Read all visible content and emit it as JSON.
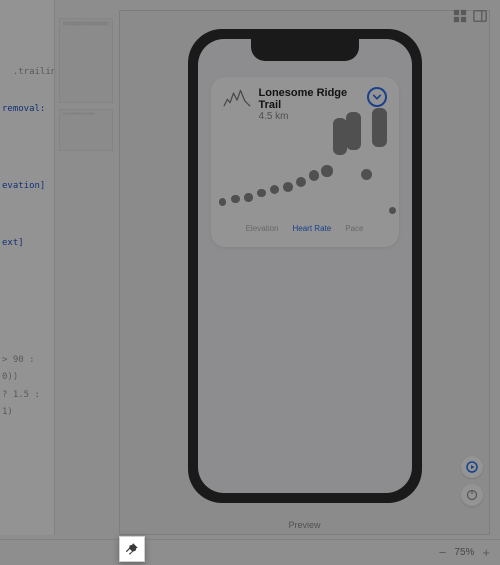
{
  "editor": {
    "snippets": [
      ".trailing)",
      "removal:",
      "evation]",
      "ext]",
      "> 90 : 0))",
      "? 1.5 : 1)"
    ],
    "keyword_color": "#2255cc"
  },
  "canvas": {
    "preview_label": "Preview",
    "toolbar": {
      "grid_icon": "grid-icon",
      "panel_icon": "panel-icon"
    },
    "controls": {
      "play": "play-icon",
      "refresh": "refresh-icon"
    }
  },
  "device": {
    "card": {
      "title": "Lonesome Ridge Trail",
      "subtitle": "4.5 km",
      "chevron": "chevron-down-icon",
      "ridge_icon": "ridge-icon"
    },
    "segments": [
      {
        "label": "Elevation",
        "active": false
      },
      {
        "label": "Heart Rate",
        "active": true
      },
      {
        "label": "Pace",
        "active": false
      }
    ]
  },
  "chart_data": {
    "type": "scatter",
    "title": "",
    "xlabel": "",
    "ylabel": "",
    "x": [
      0,
      1,
      2,
      3,
      4,
      5,
      6,
      7,
      8,
      9,
      10,
      11,
      12,
      13
    ],
    "values": [
      60,
      62,
      63,
      66,
      68,
      70,
      73,
      77,
      80,
      95,
      98,
      78,
      100,
      55
    ],
    "ylim": [
      50,
      105
    ],
    "size_scale": "value",
    "pill_indices": [
      9,
      10,
      12
    ],
    "color": "#8a8a8a",
    "series_name": "Heart Rate"
  },
  "bottombar": {
    "pin_icon": "pin-icon",
    "zoom_minus": "−",
    "zoom_value": "75%",
    "zoom_plus": "+"
  }
}
